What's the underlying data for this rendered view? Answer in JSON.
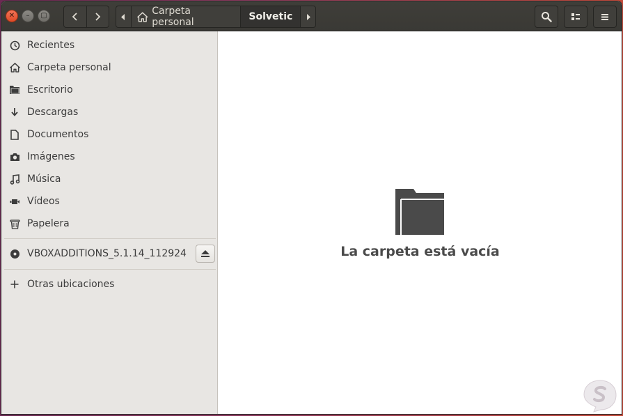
{
  "header": {
    "path": {
      "home_label": "Carpeta personal",
      "current_label": "Solvetic"
    }
  },
  "sidebar": {
    "places": [
      {
        "label": "Recientes",
        "icon": "clock-icon"
      },
      {
        "label": "Carpeta personal",
        "icon": "home-icon"
      },
      {
        "label": "Escritorio",
        "icon": "folder-icon"
      },
      {
        "label": "Descargas",
        "icon": "download-icon"
      },
      {
        "label": "Documentos",
        "icon": "document-icon"
      },
      {
        "label": "Imágenes",
        "icon": "camera-icon"
      },
      {
        "label": "Música",
        "icon": "music-icon"
      },
      {
        "label": "Vídeos",
        "icon": "video-icon"
      },
      {
        "label": "Papelera",
        "icon": "trash-icon"
      }
    ],
    "devices": [
      {
        "label": "VBOXADDITIONS_5.1.14_112924",
        "icon": "disc-icon"
      }
    ],
    "other": {
      "label": "Otras ubicaciones",
      "icon": "plus-icon"
    }
  },
  "main": {
    "empty_message": "La carpeta está vacía"
  },
  "colors": {
    "headerbar": "#3c3b37",
    "sidebar_bg": "#e8e6e3",
    "close_button": "#e9552f",
    "empty_icon": "#4a4a4a"
  }
}
